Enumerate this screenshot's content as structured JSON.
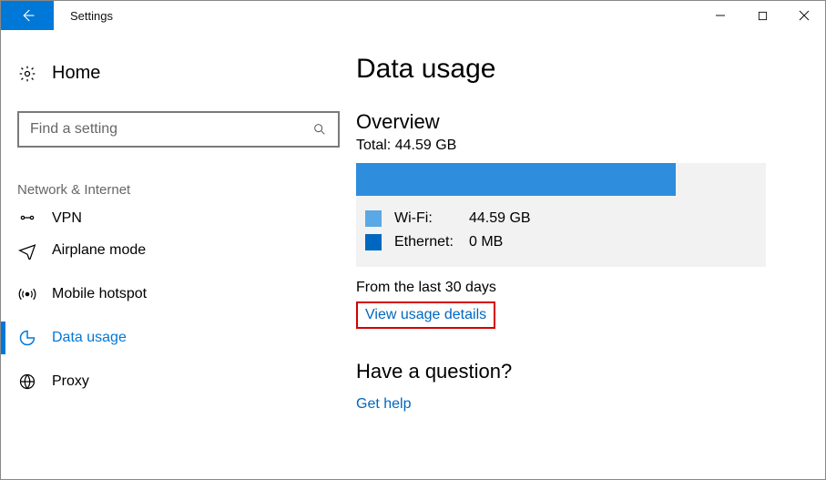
{
  "window": {
    "title": "Settings"
  },
  "sidebar": {
    "home": "Home",
    "search_placeholder": "Find a setting",
    "category": "Network & Internet",
    "items": [
      {
        "label": "VPN"
      },
      {
        "label": "Airplane mode"
      },
      {
        "label": "Mobile hotspot"
      },
      {
        "label": "Data usage"
      },
      {
        "label": "Proxy"
      }
    ]
  },
  "content": {
    "title": "Data usage",
    "overview_heading": "Overview",
    "total_label": "Total:",
    "total_value": "44.59 GB",
    "wifi_label": "Wi-Fi:",
    "wifi_value": "44.59 GB",
    "ethernet_label": "Ethernet:",
    "ethernet_value": "0 MB",
    "period_text": "From the last 30 days",
    "view_details_link": "View usage details",
    "question_heading": "Have a question?",
    "get_help_link": "Get help",
    "bar_fill_percent": 78
  }
}
